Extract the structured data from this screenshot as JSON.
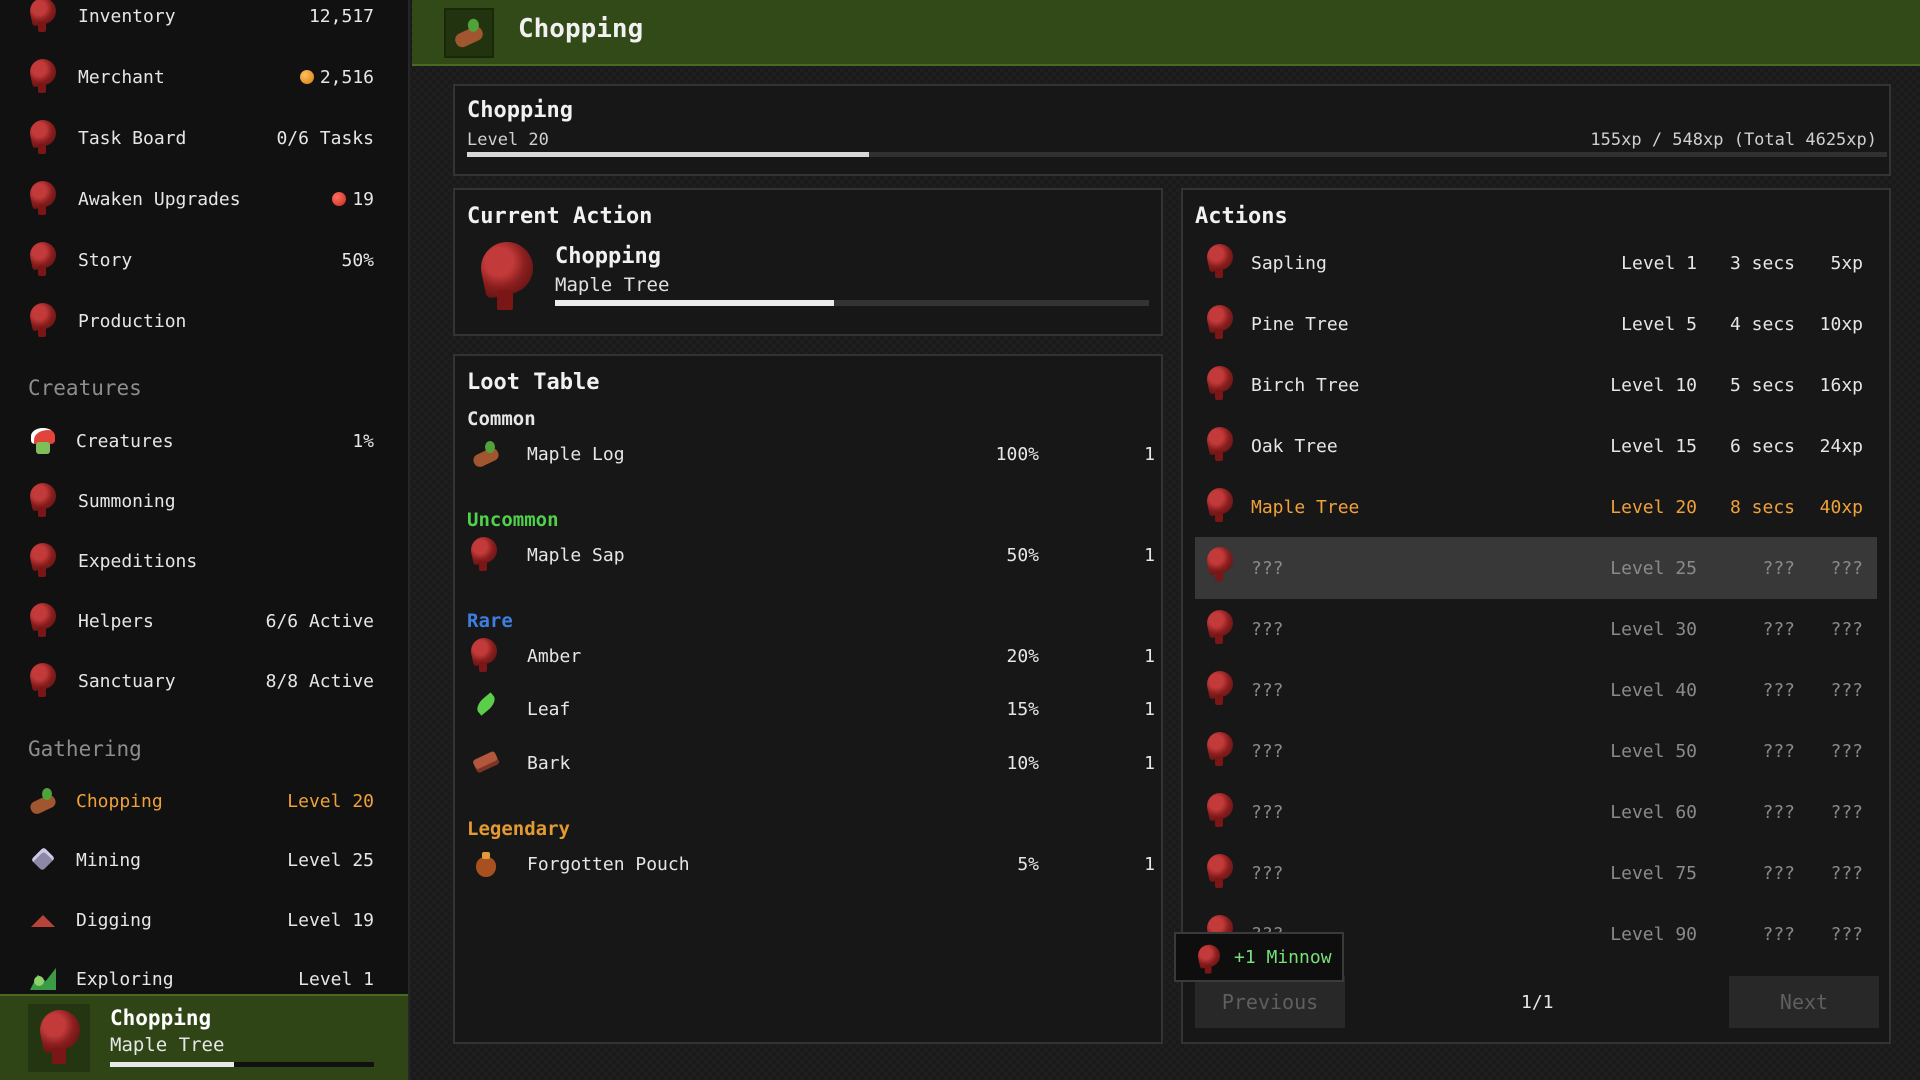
{
  "sidebar": {
    "items_top": [
      {
        "label": "Inventory",
        "value": "12,517"
      },
      {
        "label": "Merchant",
        "value": "2,516"
      },
      {
        "label": "Task Board",
        "value": "0/6 Tasks"
      },
      {
        "label": "Awaken Upgrades",
        "value": "19"
      },
      {
        "label": "Story",
        "value": "50%"
      },
      {
        "label": "Production",
        "value": ""
      }
    ],
    "sections": {
      "creatures": "Creatures",
      "gathering": "Gathering"
    },
    "creatures": [
      {
        "label": "Creatures",
        "value": "1%",
        "icon": "creature-icon"
      },
      {
        "label": "Summoning",
        "value": ""
      },
      {
        "label": "Expeditions",
        "value": ""
      },
      {
        "label": "Helpers",
        "value": "6/6 Active"
      },
      {
        "label": "Sanctuary",
        "value": "8/8 Active"
      }
    ],
    "gathering": [
      {
        "label": "Chopping",
        "value": "Level 20",
        "icon": "log-icon",
        "active": true
      },
      {
        "label": "Mining",
        "value": "Level 25",
        "icon": "gem-icon"
      },
      {
        "label": "Digging",
        "value": "Level 19",
        "icon": "shovel-icon"
      },
      {
        "label": "Exploring",
        "value": "Level 1",
        "icon": "map-icon"
      }
    ],
    "current": {
      "title": "Chopping",
      "subtitle": "Maple Tree",
      "progress": 0.47
    }
  },
  "header": {
    "title": "Chopping",
    "icon": "log-icon"
  },
  "skill": {
    "title": "Chopping",
    "level": "Level 20",
    "xp_text": "155xp / 548xp (Total 4625xp)",
    "progress": 0.283
  },
  "current_action": {
    "heading": "Current Action",
    "name": "Chopping",
    "target": "Maple Tree",
    "progress": 0.47
  },
  "loot": {
    "heading": "Loot Table",
    "categories": [
      {
        "name": "Common",
        "color": "#e6e6e6",
        "items": [
          {
            "name": "Maple Log",
            "chance": "100%",
            "qty": "1",
            "icon": "log-icon"
          }
        ]
      },
      {
        "name": "Uncommon",
        "color": "#4fd14a",
        "items": [
          {
            "name": "Maple Sap",
            "chance": "50%",
            "qty": "1",
            "icon": "unknown-icon"
          }
        ]
      },
      {
        "name": "Rare",
        "color": "#3d7fe0",
        "items": [
          {
            "name": "Amber",
            "chance": "20%",
            "qty": "1",
            "icon": "unknown-icon"
          },
          {
            "name": "Leaf",
            "chance": "15%",
            "qty": "1",
            "icon": "leaf-icon"
          },
          {
            "name": "Bark",
            "chance": "10%",
            "qty": "1",
            "icon": "bark-icon"
          }
        ]
      },
      {
        "name": "Legendary",
        "color": "#e39a30",
        "items": [
          {
            "name": "Forgotten Pouch",
            "chance": "5%",
            "qty": "1",
            "icon": "pouch-icon"
          }
        ]
      }
    ]
  },
  "actions": {
    "heading": "Actions",
    "rows": [
      {
        "name": "Sapling",
        "level": "Level 1",
        "time": "3 secs",
        "xp": "5xp",
        "state": "normal"
      },
      {
        "name": "Pine Tree",
        "level": "Level 5",
        "time": "4 secs",
        "xp": "10xp",
        "state": "normal"
      },
      {
        "name": "Birch Tree",
        "level": "Level 10",
        "time": "5 secs",
        "xp": "16xp",
        "state": "normal"
      },
      {
        "name": "Oak Tree",
        "level": "Level 15",
        "time": "6 secs",
        "xp": "24xp",
        "state": "normal"
      },
      {
        "name": "Maple Tree",
        "level": "Level 20",
        "time": "8 secs",
        "xp": "40xp",
        "state": "current"
      },
      {
        "name": "???",
        "level": "Level 25",
        "time": "???",
        "xp": "???",
        "state": "locked-hover"
      },
      {
        "name": "???",
        "level": "Level 30",
        "time": "???",
        "xp": "???",
        "state": "locked"
      },
      {
        "name": "???",
        "level": "Level 40",
        "time": "???",
        "xp": "???",
        "state": "locked"
      },
      {
        "name": "???",
        "level": "Level 50",
        "time": "???",
        "xp": "???",
        "state": "locked"
      },
      {
        "name": "???",
        "level": "Level 60",
        "time": "???",
        "xp": "???",
        "state": "locked"
      },
      {
        "name": "???",
        "level": "Level 75",
        "time": "???",
        "xp": "???",
        "state": "locked"
      },
      {
        "name": "???",
        "level": "Level 90",
        "time": "???",
        "xp": "???",
        "state": "locked"
      }
    ],
    "previous_label": "Previous",
    "next_label": "Next",
    "page": "1/1"
  },
  "toast": {
    "text": "+1 Minnow"
  },
  "colors": {
    "header_green": "#324a17",
    "accent_orange": "#f0a13a"
  }
}
